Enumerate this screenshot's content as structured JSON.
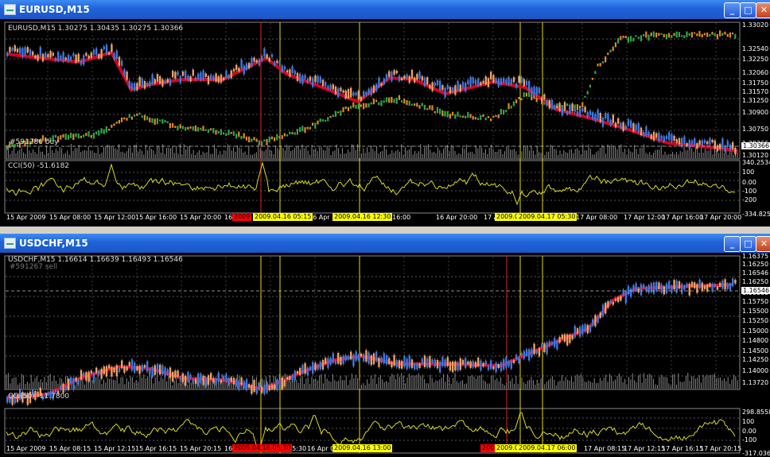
{
  "windows": [
    {
      "title": "EURUSD,M15",
      "chart_header": "EURUSD,M15  1.30275 1.30435 1.30275 1.30366",
      "order_label": "#591286 buy",
      "price_labels": [
        "1.33020",
        "1.32540",
        "1.32250",
        "1.32060",
        "1.31750",
        "1.31570",
        "1.31250",
        "1.30900",
        "1.30750",
        "1.30366",
        "1.30120"
      ],
      "current_price": "1.30366",
      "cci_header": "CCI(50) -51.6182",
      "cci_labels": [
        "340.2534",
        "100",
        "0.00",
        "-100",
        "-200",
        "-334.825"
      ],
      "time_labels": [
        "15 Apr 2009",
        "15 Apr 08:00",
        "15 Apr 12:00",
        "15 Apr 16:00",
        "15 Apr 20:00",
        "16 A",
        "16 Apr",
        "16 Apr 16:00",
        "16 Apr 20:00",
        "17 A",
        "17 Apr 08:00",
        "17 Apr 12:00",
        "17 Apr 16:00",
        "17 Apr 20:00"
      ],
      "time_highlights": [
        {
          "text": "2009",
          "color": "#ff0000"
        },
        {
          "text": "2009.04.16 05:15",
          "color": "#ffff00"
        },
        {
          "text": "2009.04.16 12:30",
          "color": "#ffff00"
        },
        {
          "text": "2009.0",
          "color": "#ffff00"
        },
        {
          "text": "2009.04.17 05:30",
          "color": "#ffff00"
        }
      ]
    },
    {
      "title": "USDCHF,M15",
      "chart_header": "USDCHF,M15  1.16614 1.16639 1.16493 1.16546",
      "order_label": "#591267 sell",
      "price_labels": [
        "1.16375",
        "1.16250",
        "1.16546",
        "1.16250",
        "1.16000",
        "1.15750",
        "1.15500",
        "1.15250",
        "1.15000",
        "1.14800",
        "1.14500",
        "1.14250",
        "1.14000",
        "1.13720"
      ],
      "current_price": "1.16546",
      "cci_header": "CCI(50) -11.7800",
      "cci_labels": [
        "298.8558",
        "100",
        "0.00",
        "-100",
        "-317.036"
      ],
      "time_labels": [
        "15 Apr 2009",
        "15 Apr 08:15",
        "15 Apr 12:15",
        "15 Apr 16:15",
        "15 Apr 20:15",
        "16 A",
        "05:30",
        "16 Apr 0",
        "17 Apr 08:15",
        "17 Apr 12:15",
        "17 Apr 16:15",
        "17 Apr 20:15"
      ],
      "time_highlights": [
        {
          "text": "2009.04.16 05:30",
          "color": "#ff0000"
        },
        {
          "text": "2009.04.16 13:00",
          "color": "#ffff00"
        },
        {
          "text": "2009",
          "color": "#ff0000"
        },
        {
          "text": "2009.0",
          "color": "#ffff00"
        },
        {
          "text": "2009.04.17 06:00",
          "color": "#ffff00"
        }
      ]
    }
  ],
  "colors": {
    "bull": "#3a78e8",
    "bear": "#ff3a00",
    "ma": "#e8002a",
    "ma_fast": "#2aa84a",
    "cci": "#d8d820",
    "vline_red": "#e02020",
    "vline_yellow": "#e8d800"
  }
}
